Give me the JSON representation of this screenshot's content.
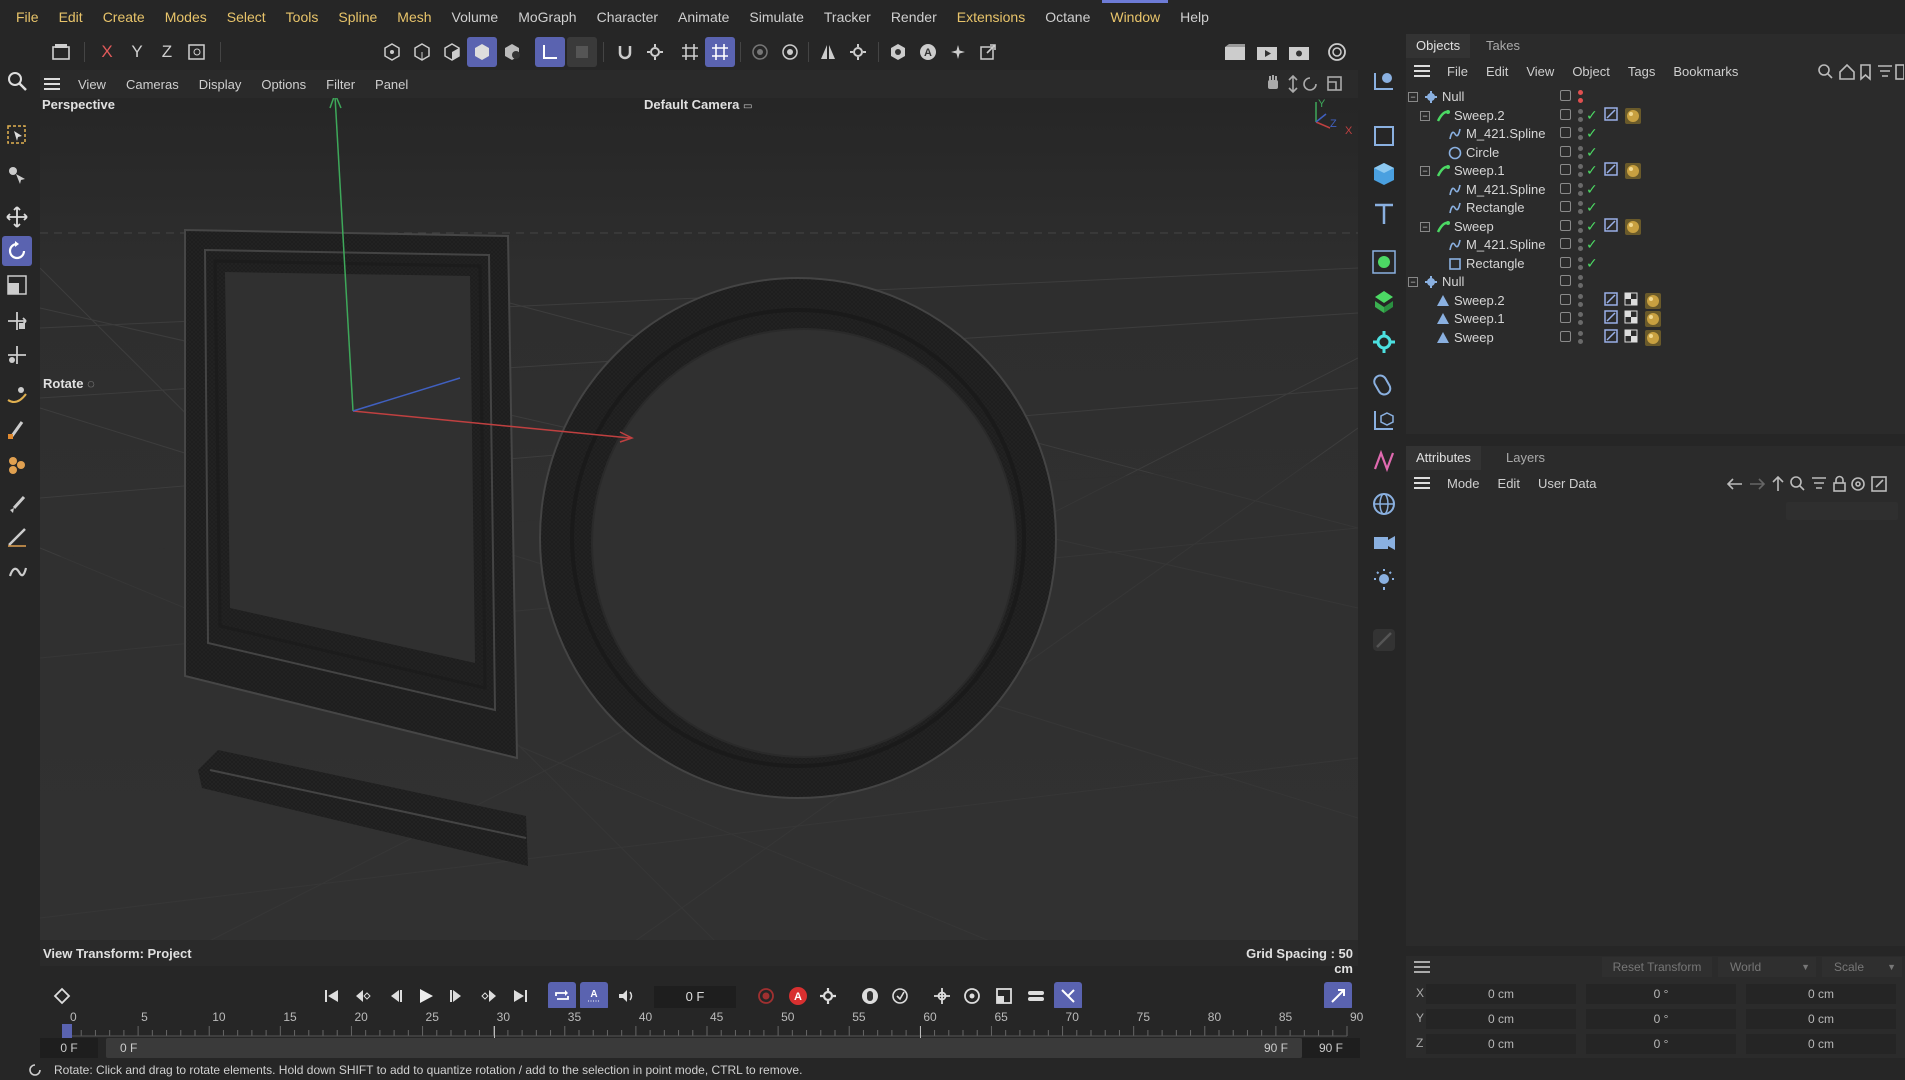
{
  "menubar": {
    "items": [
      {
        "label": "File"
      },
      {
        "label": "Edit"
      },
      {
        "label": "Create"
      },
      {
        "label": "Modes"
      },
      {
        "label": "Select"
      },
      {
        "label": "Tools"
      },
      {
        "label": "Spline"
      },
      {
        "label": "Mesh"
      },
      {
        "label": "Volume"
      },
      {
        "label": "MoGraph"
      },
      {
        "label": "Character"
      },
      {
        "label": "Animate"
      },
      {
        "label": "Simulate"
      },
      {
        "label": "Tracker"
      },
      {
        "label": "Render"
      },
      {
        "label": "Extensions"
      },
      {
        "label": "Octane"
      },
      {
        "label": "Window"
      },
      {
        "label": "Help"
      }
    ],
    "highlighted": [
      "File",
      "Edit",
      "Create",
      "Modes",
      "Select",
      "Tools",
      "Spline",
      "Mesh",
      "Extensions",
      "Window"
    ],
    "active": "Window"
  },
  "toolbar": {
    "axis_x": "X",
    "axis_y": "Y",
    "axis_z": "Z"
  },
  "viewport": {
    "menu": [
      "View",
      "Cameras",
      "Display",
      "Options",
      "Filter",
      "Panel"
    ],
    "projection": "Perspective",
    "camera": "Default Camera",
    "camera_icon": "camera-link-icon",
    "tool_hint": "Rotate",
    "view_transform": "View Transform: Project",
    "grid_spacing": "Grid Spacing : 50 cm",
    "axis_labels": {
      "y": "Y",
      "z": "Z",
      "x": "X"
    }
  },
  "objects_panel": {
    "tabs": [
      "Objects",
      "Takes"
    ],
    "active_tab": "Objects",
    "menu": [
      "File",
      "Edit",
      "View",
      "Object",
      "Tags",
      "Bookmarks"
    ],
    "rows": [
      {
        "label": "Null",
        "indent": 0,
        "expander": "−",
        "icon": "null-icon",
        "check": false,
        "dotcolor": "#e05050",
        "tags": []
      },
      {
        "label": "Sweep.2",
        "indent": 1,
        "expander": "−",
        "icon": "sweep-icon",
        "check": true,
        "tags": [
          "phong-tag-icon",
          "material-tag-icon"
        ]
      },
      {
        "label": "M_421.Spline",
        "indent": 2,
        "expander": "",
        "icon": "spline-icon",
        "check": true,
        "tags": []
      },
      {
        "label": "Circle",
        "indent": 2,
        "expander": "",
        "icon": "circle-icon",
        "check": true,
        "tags": []
      },
      {
        "label": "Sweep.1",
        "indent": 1,
        "expander": "−",
        "icon": "sweep-icon",
        "check": true,
        "tags": [
          "phong-tag-icon",
          "material-tag-icon"
        ]
      },
      {
        "label": "M_421.Spline",
        "indent": 2,
        "expander": "",
        "icon": "spline-icon",
        "check": true,
        "tags": []
      },
      {
        "label": "Rectangle",
        "indent": 2,
        "expander": "",
        "icon": "spline-icon",
        "check": true,
        "tags": []
      },
      {
        "label": "Sweep",
        "indent": 1,
        "expander": "−",
        "icon": "sweep-icon",
        "check": true,
        "tags": [
          "phong-tag-icon",
          "material-tag-icon"
        ]
      },
      {
        "label": "M_421.Spline",
        "indent": 2,
        "expander": "",
        "icon": "spline-icon",
        "check": true,
        "tags": []
      },
      {
        "label": "Rectangle",
        "indent": 2,
        "expander": "",
        "icon": "rectangle-icon",
        "check": true,
        "tags": []
      },
      {
        "label": "Null",
        "indent": 0,
        "expander": "−",
        "icon": "null-icon",
        "check": false,
        "tags": []
      },
      {
        "label": "Sweep.2",
        "indent": 1,
        "expander": "",
        "icon": "polygon-icon",
        "check": false,
        "tags": [
          "phong-tag-icon",
          "uvw-tag-icon",
          "material-tag-icon"
        ]
      },
      {
        "label": "Sweep.1",
        "indent": 1,
        "expander": "",
        "icon": "polygon-icon",
        "check": false,
        "tags": [
          "phong-tag-icon",
          "uvw-tag-icon",
          "material-tag-icon"
        ]
      },
      {
        "label": "Sweep",
        "indent": 1,
        "expander": "",
        "icon": "polygon-icon",
        "check": false,
        "tags": [
          "phong-tag-icon",
          "uvw-tag-icon",
          "material-tag-icon"
        ]
      }
    ]
  },
  "attributes_panel": {
    "tabs": [
      "Attributes",
      "Layers"
    ],
    "active_tab": "Attributes",
    "menu": [
      "Mode",
      "Edit",
      "User Data"
    ]
  },
  "coordinates": {
    "reset_label": "Reset Transform",
    "space": "World",
    "mode": "Scale",
    "rows": [
      {
        "axis": "X",
        "pos": "0 cm",
        "rot": "0 °",
        "scale": "0 cm"
      },
      {
        "axis": "Y",
        "pos": "0 cm",
        "rot": "0 °",
        "scale": "0 cm"
      },
      {
        "axis": "Z",
        "pos": "0 cm",
        "rot": "0 °",
        "scale": "0 cm"
      }
    ]
  },
  "timeline": {
    "current_frame": "0 F",
    "ticks": [
      "0",
      "5",
      "10",
      "15",
      "20",
      "25",
      "30",
      "35",
      "40",
      "45",
      "50",
      "55",
      "60",
      "65",
      "70",
      "75",
      "80",
      "85",
      "90"
    ],
    "range_start": "0 F",
    "range_start2": "0 F",
    "range_end": "90 F",
    "range_end2": "90 F"
  },
  "status": {
    "text": "Rotate: Click and drag to rotate elements. Hold down SHIFT to add to quantize rotation / add to the selection in point mode, CTRL to remove."
  },
  "colors": {
    "accent": "#5a63b0",
    "highlight_text": "#e8c46a",
    "check_green": "#4cd964",
    "axis_x": "#d04040",
    "axis_y": "#40c060",
    "axis_z": "#4070d0"
  }
}
